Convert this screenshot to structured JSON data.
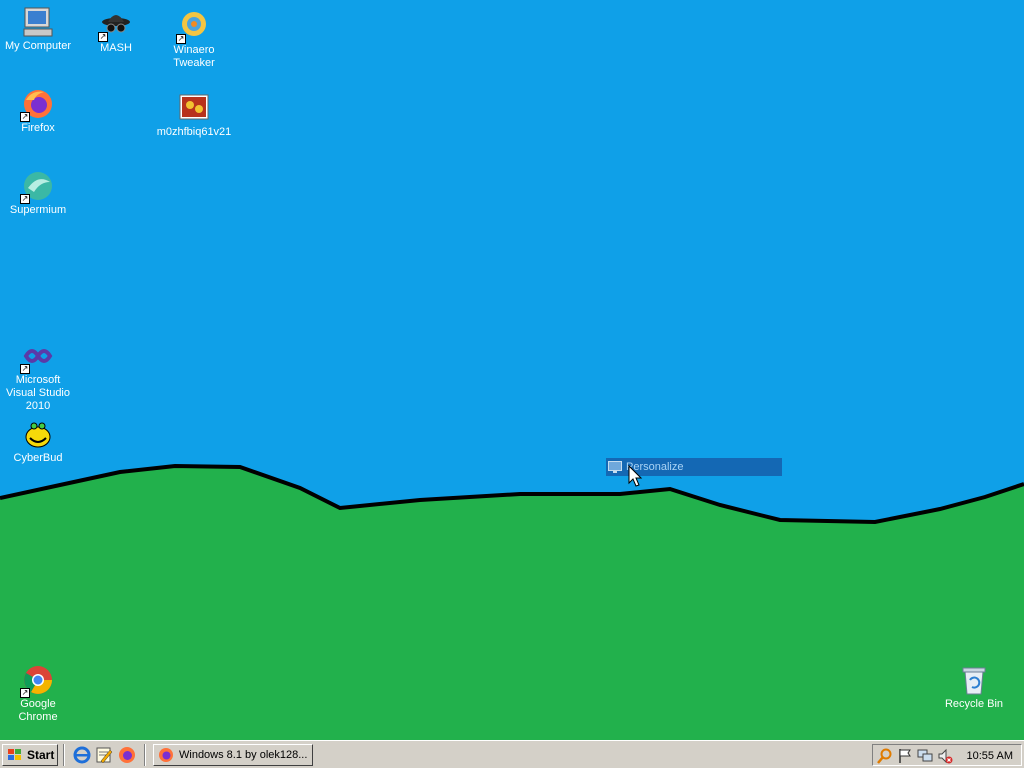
{
  "desktop": {
    "icons": [
      {
        "label": "My Computer"
      },
      {
        "label": "MASH"
      },
      {
        "label": "Winaero Tweaker"
      },
      {
        "label": "Firefox"
      },
      {
        "label": "m0zhfbiq61v21"
      },
      {
        "label": "Supermium"
      },
      {
        "label": "Microsoft Visual Studio 2010"
      },
      {
        "label": "CyberBud"
      },
      {
        "label": "Google Chrome"
      },
      {
        "label": "Recycle Bin"
      }
    ],
    "context_item": {
      "label": "Personalize"
    },
    "colors": {
      "sky": "#0fa0e8",
      "grass": "#22b14c",
      "outline": "#000000"
    }
  },
  "taskbar": {
    "start_label": "Start",
    "quick_launch": [
      "internet-explorer-icon",
      "notepad-icon",
      "firefox-icon"
    ],
    "tasks": [
      {
        "label": "Windows 8.1 by olek128..."
      }
    ],
    "tray_icons": [
      "search-icon",
      "flag-icon",
      "network-icon",
      "volume-muted-icon"
    ],
    "clock": "10:55 AM"
  }
}
